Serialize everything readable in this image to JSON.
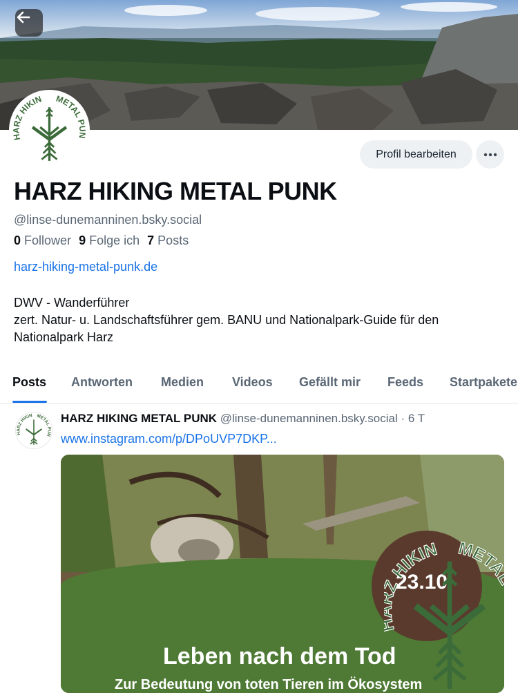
{
  "profile": {
    "display_name": "HARZ HIKING METAL PUNK",
    "handle": "@linse-dunemanninen.bsky.social",
    "edit_button": "Profil bearbeiten",
    "stats": {
      "followers_count": "0",
      "followers_label": "Follower",
      "following_count": "9",
      "following_label": "Folge ich",
      "posts_count": "7",
      "posts_label": "Posts"
    },
    "website": "harz-hiking-metal-punk.de",
    "bio_line1": "DWV - Wanderführer",
    "bio_line2": "zert. Natur- u. Landschaftsführer gem. BANU und Nationalpark-Guide für den Nationalpark Harz",
    "avatar_logo": "HARZ HIKING METAL PUNK"
  },
  "tabs": [
    {
      "label": "Posts",
      "active": true
    },
    {
      "label": "Antworten",
      "active": false
    },
    {
      "label": "Medien",
      "active": false
    },
    {
      "label": "Videos",
      "active": false
    },
    {
      "label": "Gefällt mir",
      "active": false
    },
    {
      "label": "Feeds",
      "active": false
    },
    {
      "label": "Startpakete",
      "active": false
    }
  ],
  "post": {
    "author_name": "HARZ HIKING METAL PUNK",
    "author_handle": "@linse-dunemanninen.bsky.social",
    "separator": "·",
    "time": "6 T",
    "link": "www.instagram.com/p/DPoUVP7DKP...",
    "image": {
      "date_badge": "23.10",
      "title": "Leben nach dem Tod",
      "subtitle": "Zur Bedeutung von toten Tieren im Ökosystem"
    }
  },
  "colors": {
    "accent": "#1a73e8",
    "logo_green": "#3c6b3a",
    "muted_text": "#5a6775"
  },
  "icons": {
    "back": "arrow-left-icon",
    "more": "ellipsis-icon"
  }
}
